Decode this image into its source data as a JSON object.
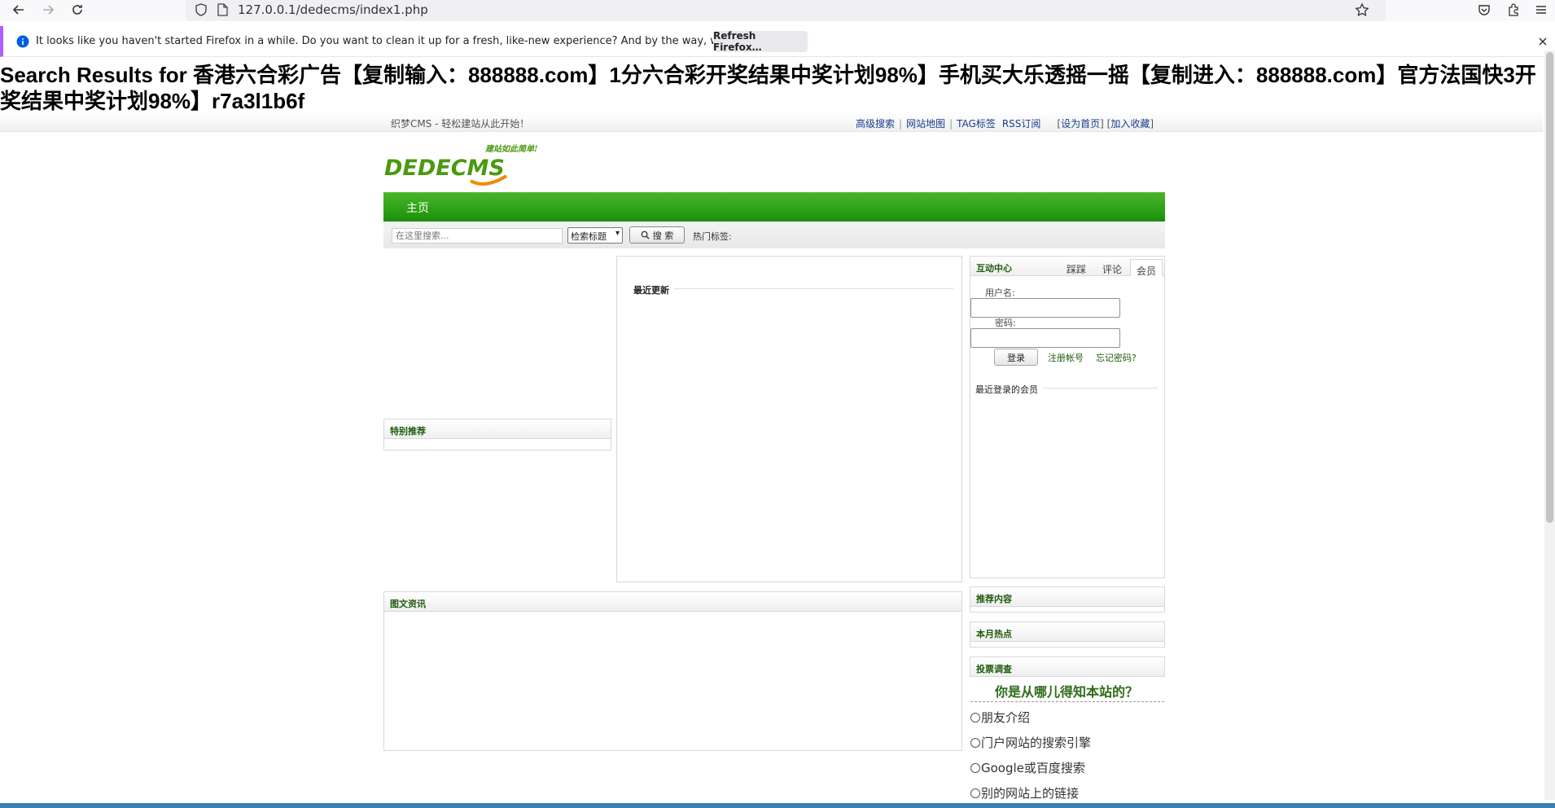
{
  "browser": {
    "url": "127.0.0.1/dedecms/index1.php",
    "notification": "It looks like you haven't started Firefox in a while. Do you want to clean it up for a fresh, like-new experience? And by the way, welcome back!",
    "refresh_button": "Refresh Firefox…",
    "icons": [
      "back-icon",
      "forward-icon",
      "reload-icon",
      "shield-icon",
      "page-icon",
      "bookmark-star-icon",
      "pocket-icon",
      "extensions-icon",
      "menu-icon",
      "info-icon",
      "close-icon"
    ]
  },
  "page": {
    "title": "Search Results for 香港六合彩广告【复制输入：888888.com】1分六合彩开奖结果中奖计划98%】手机买大乐透摇一摇【复制进入：888888.com】官方法国快3开奖结果中奖计划98%】r7a3l1b6f"
  },
  "topbar": {
    "slogan": "织梦CMS - 轻松建站从此开始！",
    "links": {
      "advanced_search": "高级搜索",
      "site_map": "网站地图",
      "tags": "TAG标签",
      "rss": "RSS订阅",
      "set_home": "设为首页",
      "add_favorite": "加入收藏"
    }
  },
  "logo": {
    "text": "DEDECMS",
    "tagline": "建站如此简单!",
    "colors": {
      "green": "#4a9a10",
      "orange": "#f08a00"
    }
  },
  "nav": {
    "home": "主页"
  },
  "search": {
    "placeholder": "在这里搜索...",
    "select": "检索标题",
    "button": "搜 索",
    "hot_tags": "热门标签:"
  },
  "panels": {
    "featured": "特别推荐",
    "latest_updates": "最近更新",
    "photo_news": "图文资讯",
    "recommended": "推荐内容",
    "monthly_hot": "本月热点",
    "poll": "投票调查"
  },
  "member": {
    "title": "互动中心",
    "tabs": {
      "tab1": "踩踩",
      "tab2": "评论",
      "tab3": "会员"
    },
    "username_label": "用户名:",
    "password_label": "密码:",
    "login_button": "登录",
    "register": "注册帐号",
    "forgot": "忘记密码?",
    "recent_members": "最近登录的会员"
  },
  "poll": {
    "question": "你是从哪儿得知本站的？",
    "options": [
      "朋友介绍",
      "门户网站的搜索引擎",
      "Google或百度搜索",
      "别的网站上的链接"
    ]
  },
  "colors": {
    "nav_green": "#1a8f0a",
    "title_green": "#1f5b0d",
    "link_blue": "#1a3a8a"
  }
}
